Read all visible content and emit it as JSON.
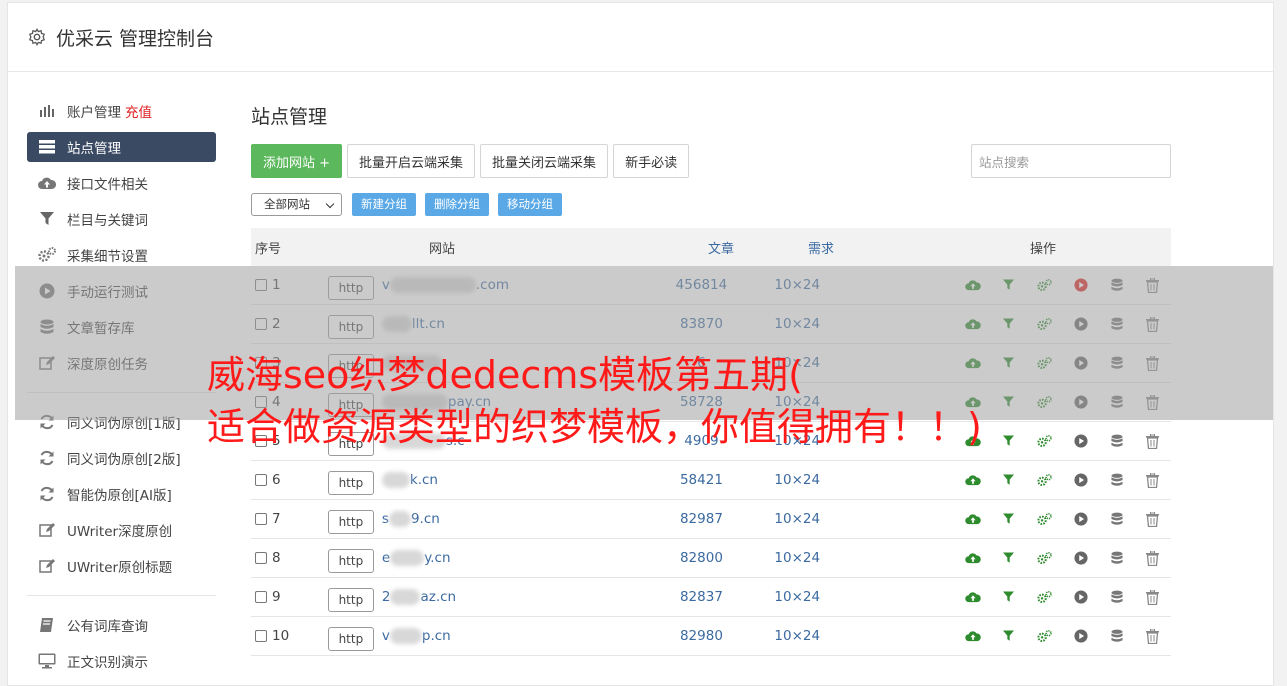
{
  "app": {
    "title": "优采云 管理控制台"
  },
  "sidebar": {
    "group1": [
      {
        "label": "账户管理",
        "icon": "bar-chart-icon",
        "extra": "充值"
      },
      {
        "label": "站点管理",
        "icon": "server-list-icon",
        "active": true
      },
      {
        "label": "接口文件相关",
        "icon": "cloud-upload-icon"
      },
      {
        "label": "栏目与关键词",
        "icon": "filter-icon"
      },
      {
        "label": "采集细节设置",
        "icon": "gears-icon"
      },
      {
        "label": "手动运行测试",
        "icon": "play-circle-icon"
      },
      {
        "label": "文章暂存库",
        "icon": "database-icon"
      },
      {
        "label": "深度原创任务",
        "icon": "edit-icon"
      }
    ],
    "group2": [
      {
        "label": "同义词伪原创[1版]",
        "icon": "refresh-icon"
      },
      {
        "label": "同义词伪原创[2版]",
        "icon": "refresh-icon"
      },
      {
        "label": "智能伪原创[AI版]",
        "icon": "refresh-icon"
      },
      {
        "label": "UWriter深度原创",
        "icon": "edit-icon"
      },
      {
        "label": "UWriter原创标题",
        "icon": "edit-icon"
      }
    ],
    "group3": [
      {
        "label": "公有词库查询",
        "icon": "book-icon"
      },
      {
        "label": "正文识别演示",
        "icon": "monitor-icon"
      }
    ]
  },
  "main": {
    "title": "站点管理",
    "buttons": {
      "add": "添加网站 +",
      "batch_open": "批量开启云端采集",
      "batch_close": "批量关闭云端采集",
      "guide": "新手必读"
    },
    "search_placeholder": "站点搜索",
    "group_select": "全部网站",
    "group_buttons": {
      "new": "新建分组",
      "delete": "删除分组",
      "move": "移动分组"
    }
  },
  "table": {
    "headers": {
      "no": "序号",
      "site": "网站",
      "articles": "文章",
      "need": "需求",
      "ops": "操作"
    },
    "rows": [
      {
        "no": "1",
        "proto": "http",
        "prefix": "v",
        "suffix": ".com",
        "articles": "456814",
        "need": "10×24",
        "running": true
      },
      {
        "no": "2",
        "proto": "http",
        "prefix": "",
        "suffix": "llt.cn",
        "articles": "83870",
        "need": "10×24"
      },
      {
        "no": "3",
        "proto": "http",
        "prefix": "",
        "suffix": "",
        "articles": "6",
        "need": "10×24"
      },
      {
        "no": "4",
        "proto": "http",
        "prefix": "",
        "suffix": "pay.cn",
        "articles": "58728",
        "need": "10×24"
      },
      {
        "no": "5",
        "proto": "http",
        "prefix": "",
        "suffix": "s.c",
        "articles": "4909",
        "need": "10×24"
      },
      {
        "no": "6",
        "proto": "http",
        "prefix": "",
        "suffix": "k.cn",
        "articles": "58421",
        "need": "10×24"
      },
      {
        "no": "7",
        "proto": "http",
        "prefix": "s",
        "suffix": "9.cn",
        "articles": "82987",
        "need": "10×24"
      },
      {
        "no": "8",
        "proto": "http",
        "prefix": "e",
        "suffix": "y.cn",
        "articles": "82800",
        "need": "10×24"
      },
      {
        "no": "9",
        "proto": "http",
        "prefix": "2",
        "suffix": "az.cn",
        "articles": "82837",
        "need": "10×24"
      },
      {
        "no": "10",
        "proto": "http",
        "prefix": "v",
        "suffix": "p.cn",
        "articles": "82980",
        "need": "10×24"
      }
    ]
  },
  "overlay": {
    "line1": "威海seo织梦dedecms模板第五期(",
    "line2": "适合做资源类型的织梦模板，你值得拥有！！)"
  },
  "colors": {
    "accent_green": "#5cb85c",
    "accent_blue": "#5aa9e6",
    "sidebar_active": "#3a4a63",
    "link": "#3b6aa0",
    "banner_red": "#ff1a1a"
  }
}
